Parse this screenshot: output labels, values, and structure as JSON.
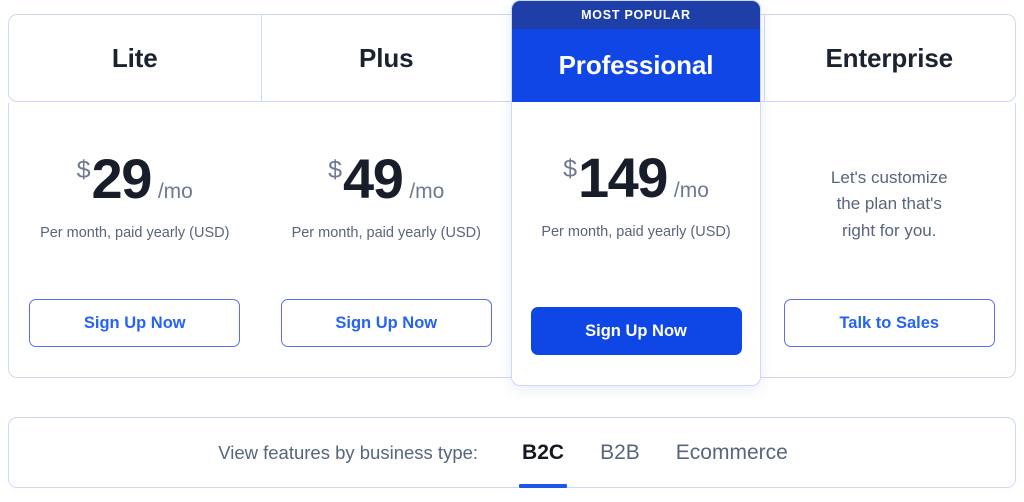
{
  "colors": {
    "brand_blue": "#0f46e5",
    "ribbon_navy": "#1e3fa8",
    "outline_border": "#5b6df0",
    "card_border": "#ccd9fb",
    "muted_text": "#58657c",
    "heading_text": "#1b2230",
    "active_tab_underline": "#1f55ef"
  },
  "plans": [
    {
      "name": "Lite",
      "featured": false,
      "ribbon": null,
      "price_currency": "$",
      "price_amount": "29",
      "price_period": "/mo",
      "price_note": "Per month, paid yearly (USD)",
      "custom_copy": null,
      "cta_label": "Sign Up Now",
      "cta_style": "outline"
    },
    {
      "name": "Plus",
      "featured": false,
      "ribbon": null,
      "price_currency": "$",
      "price_amount": "49",
      "price_period": "/mo",
      "price_note": "Per month, paid yearly (USD)",
      "custom_copy": null,
      "cta_label": "Sign Up Now",
      "cta_style": "outline"
    },
    {
      "name": "Professional",
      "featured": true,
      "ribbon": "MOST POPULAR",
      "price_currency": "$",
      "price_amount": "149",
      "price_period": "/mo",
      "price_note": "Per month, paid yearly (USD)",
      "custom_copy": null,
      "cta_label": "Sign Up Now",
      "cta_style": "solid"
    },
    {
      "name": "Enterprise",
      "featured": false,
      "ribbon": null,
      "price_currency": null,
      "price_amount": null,
      "price_period": null,
      "price_note": null,
      "custom_copy": "Let's customize\nthe plan that's\nright for you.",
      "cta_label": "Talk to Sales",
      "cta_style": "outline"
    }
  ],
  "business_type": {
    "label": "View features by business type:",
    "tabs": [
      {
        "label": "B2C",
        "active": true
      },
      {
        "label": "B2B",
        "active": false
      },
      {
        "label": "Ecommerce",
        "active": false
      }
    ]
  }
}
